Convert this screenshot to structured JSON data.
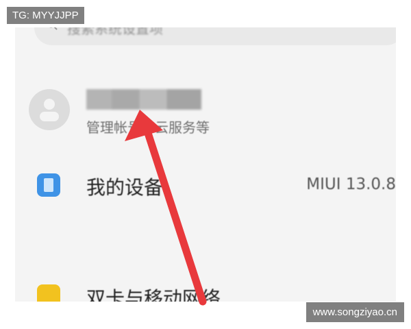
{
  "search": {
    "placeholder": "搜索系统设置项"
  },
  "account": {
    "name": "·",
    "subtitle": "管理帐号、云服务等"
  },
  "device": {
    "label": "我的设备",
    "value": "MIUI 13.0.8"
  },
  "network": {
    "label": "双卡与移动网络"
  },
  "watermarks": {
    "top": "TG: MYYJJPP",
    "bottom": "www.songziyao.cn"
  },
  "colors": {
    "arrow": "#e8393c",
    "device_icon": "#3f93e6",
    "sim_icon": "#f2c21f"
  }
}
